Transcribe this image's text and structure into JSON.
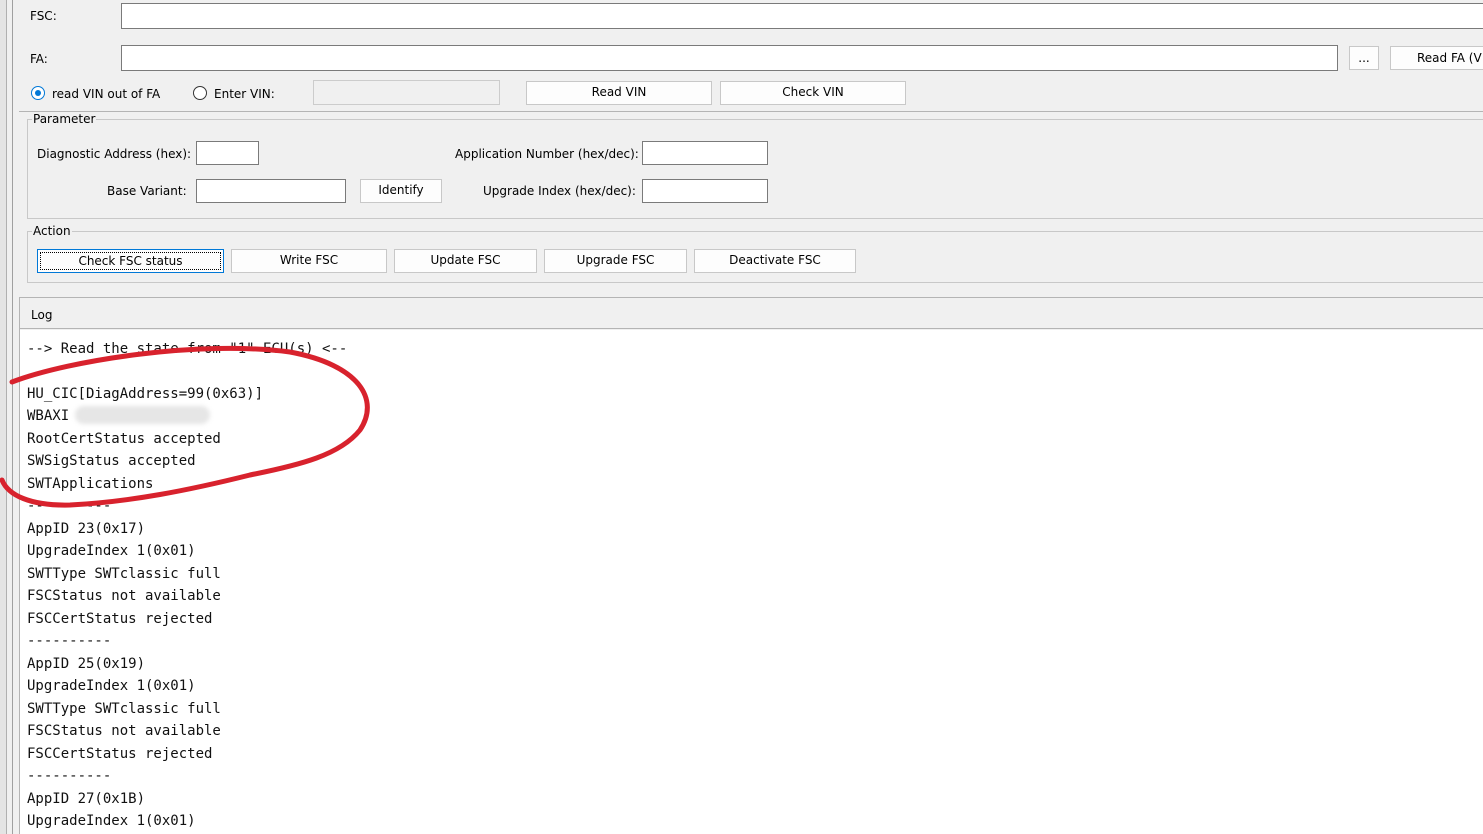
{
  "form": {
    "fsc_label": "FSC:",
    "fsc_value": "",
    "fa_label": "FA:",
    "fa_value": "",
    "browse_label": "...",
    "read_fa_label": "Read FA (V",
    "vin_radio_fa_label": "read VIN out of FA",
    "vin_radio_enter_label": "Enter VIN:",
    "vin_value": "",
    "read_vin_label": "Read VIN",
    "check_vin_label": "Check VIN"
  },
  "parameter": {
    "title": "Parameter",
    "diag_address_label": "Diagnostic Address (hex):",
    "diag_address_value": "",
    "base_variant_label": "Base Variant:",
    "base_variant_value": "",
    "identify_label": "Identify",
    "app_number_label": "Application Number (hex/dec):",
    "app_number_value": "",
    "upgrade_index_label": "Upgrade Index (hex/dec):",
    "upgrade_index_value": ""
  },
  "action": {
    "title": "Action",
    "buttons": [
      "Check FSC status",
      "Write FSC",
      "Update FSC",
      "Upgrade FSC",
      "Deactivate FSC"
    ]
  },
  "log": {
    "title": "Log",
    "lines": [
      "--> Read the state from \"1\" ECU(s) <--",
      "",
      "HU_CIC[DiagAddress=99(0x63)]",
      "WBAXI",
      "RootCertStatus accepted",
      "SWSigStatus accepted",
      "SWTApplications",
      "----------",
      "AppID 23(0x17)",
      "UpgradeIndex 1(0x01)",
      "SWTType SWTclassic full",
      "FSCStatus not available",
      "FSCCertStatus rejected",
      "----------",
      "AppID 25(0x19)",
      "UpgradeIndex 1(0x01)",
      "SWTType SWTclassic full",
      "FSCStatus not available",
      "FSCCertStatus rejected",
      "----------",
      "AppID 27(0x1B)",
      "UpgradeIndex 1(0x01)"
    ]
  },
  "colors": {
    "annotation": "#d8222d",
    "focus": "#0078d7",
    "window_bg": "#f0f0f0"
  }
}
